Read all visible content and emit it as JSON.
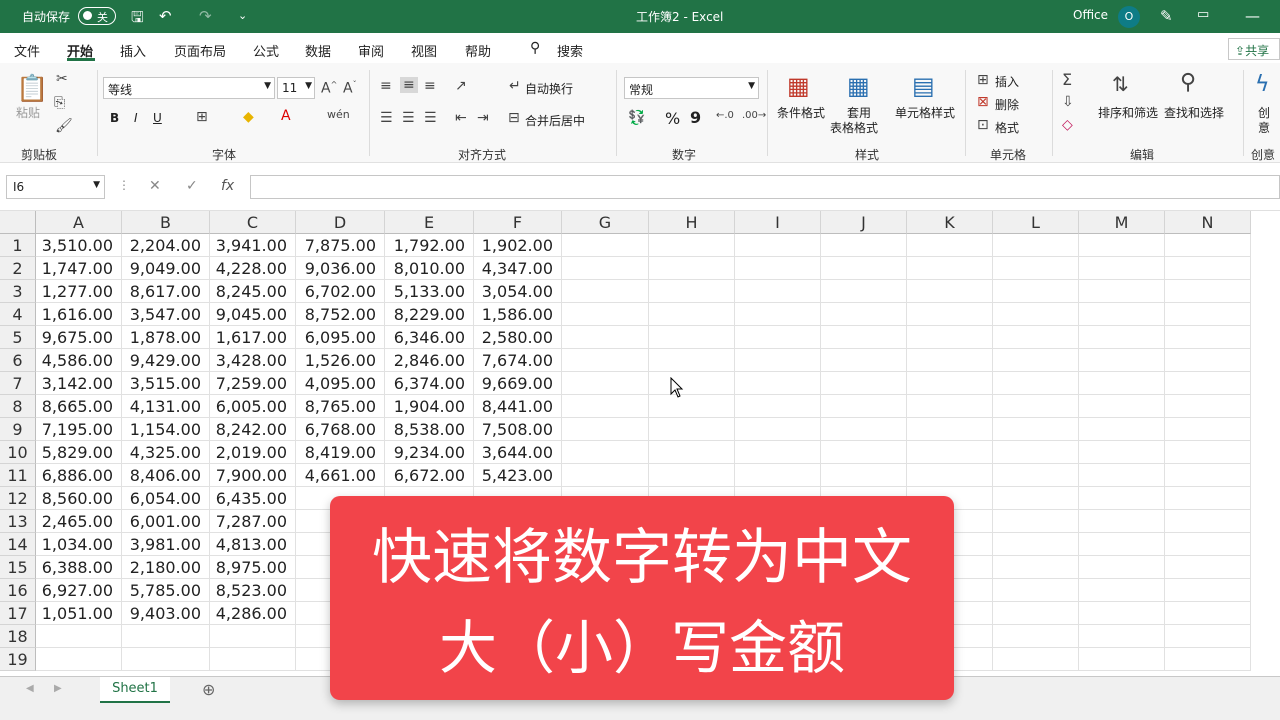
{
  "titlebar": {
    "autosave_label": "自动保存",
    "autosave_state": "关",
    "window_title": "工作簿2 - Excel",
    "account": "Office",
    "avatar_letter": "O",
    "icons": [
      "save-icon",
      "undo-icon",
      "redo-icon",
      "customize-icon",
      "pen-icon",
      "ribbon-display-icon",
      "minimize-icon"
    ]
  },
  "tabs": [
    "文件",
    "开始",
    "插入",
    "页面布局",
    "公式",
    "数据",
    "审阅",
    "视图",
    "帮助"
  ],
  "search_label": "搜索",
  "share_label": "共享",
  "ribbon": {
    "clipboard": {
      "paste": "粘贴",
      "group": "剪贴板"
    },
    "font": {
      "name": "等线",
      "size": "11",
      "bold": "B",
      "italic": "I",
      "underline": "U",
      "group": "字体"
    },
    "alignment": {
      "wrap": "自动换行",
      "merge": "合并后居中",
      "group": "对齐方式"
    },
    "number": {
      "format": "常规",
      "percent": "%",
      "comma": "9",
      "group": "数字"
    },
    "styles": {
      "conditional": "条件格式",
      "table1": "套用",
      "table2": "表格格式",
      "cell_styles": "单元格样式",
      "group": "样式"
    },
    "cells": {
      "insert": "插入",
      "delete": "删除",
      "format": "格式",
      "group": "单元格"
    },
    "editing": {
      "sort": "排序和筛选",
      "find": "查找和选择",
      "group": "编辑"
    },
    "creative": {
      "label1": "创",
      "label2": "意",
      "group": "创意"
    }
  },
  "formula_bar": {
    "name_box": "I6",
    "fx": "fx",
    "cancel": "✕",
    "enter": "✓",
    "content": ""
  },
  "columns": [
    "A",
    "B",
    "C",
    "D",
    "E",
    "F",
    "G",
    "H",
    "I",
    "J",
    "K",
    "L",
    "M",
    "N"
  ],
  "rows": [
    [
      "3,510.00",
      "2,204.00",
      "3,941.00",
      "7,875.00",
      "1,792.00",
      "1,902.00"
    ],
    [
      "1,747.00",
      "9,049.00",
      "4,228.00",
      "9,036.00",
      "8,010.00",
      "4,347.00"
    ],
    [
      "1,277.00",
      "8,617.00",
      "8,245.00",
      "6,702.00",
      "5,133.00",
      "3,054.00"
    ],
    [
      "1,616.00",
      "3,547.00",
      "9,045.00",
      "8,752.00",
      "8,229.00",
      "1,586.00"
    ],
    [
      "9,675.00",
      "1,878.00",
      "1,617.00",
      "6,095.00",
      "6,346.00",
      "2,580.00"
    ],
    [
      "4,586.00",
      "9,429.00",
      "3,428.00",
      "1,526.00",
      "2,846.00",
      "7,674.00"
    ],
    [
      "3,142.00",
      "3,515.00",
      "7,259.00",
      "4,095.00",
      "6,374.00",
      "9,669.00"
    ],
    [
      "8,665.00",
      "4,131.00",
      "6,005.00",
      "8,765.00",
      "1,904.00",
      "8,441.00"
    ],
    [
      "7,195.00",
      "1,154.00",
      "8,242.00",
      "6,768.00",
      "8,538.00",
      "7,508.00"
    ],
    [
      "5,829.00",
      "4,325.00",
      "2,019.00",
      "8,419.00",
      "9,234.00",
      "3,644.00"
    ],
    [
      "6,886.00",
      "8,406.00",
      "7,900.00",
      "4,661.00",
      "6,672.00",
      "5,423.00"
    ],
    [
      "8,560.00",
      "6,054.00",
      "6,435.00",
      "",
      "",
      ""
    ],
    [
      "2,465.00",
      "6,001.00",
      "7,287.00",
      "",
      "",
      ""
    ],
    [
      "1,034.00",
      "3,981.00",
      "4,813.00",
      "",
      "",
      ""
    ],
    [
      "6,388.00",
      "2,180.00",
      "8,975.00",
      "",
      "",
      ""
    ],
    [
      "6,927.00",
      "5,785.00",
      "8,523.00",
      "",
      "",
      ""
    ],
    [
      "1,051.00",
      "9,403.00",
      "4,286.00",
      "",
      "",
      ""
    ],
    [
      "",
      "",
      "",
      "",
      "",
      ""
    ],
    [
      "",
      "",
      "",
      "",
      "",
      ""
    ]
  ],
  "sheet": {
    "name": "Sheet1",
    "add": "⊕"
  },
  "banner": {
    "line1": "快速将数字转为中文",
    "line2": "大（小）写金额"
  }
}
